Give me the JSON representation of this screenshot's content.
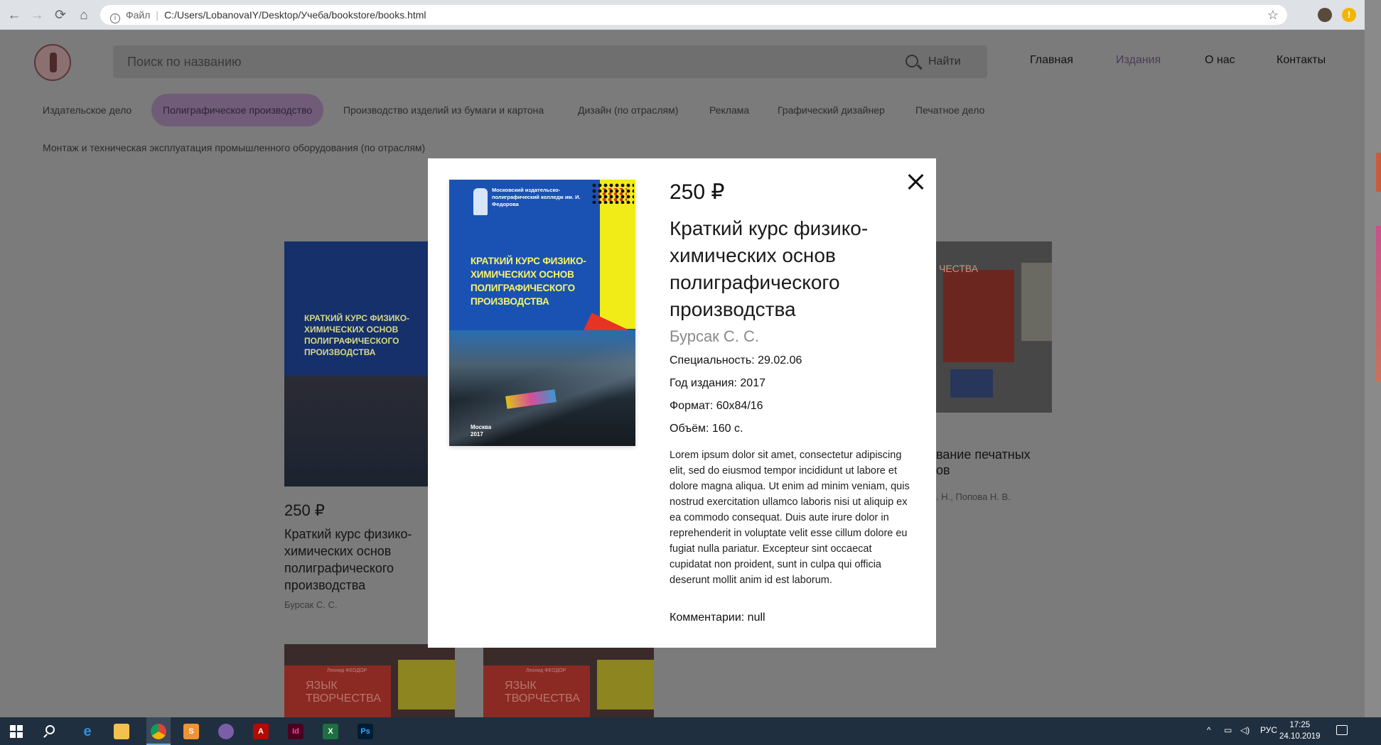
{
  "browser": {
    "scheme_label": "Файл",
    "url": "C:/Users/LobanovaIY/Desktop/Учеба/bookstore/books.html"
  },
  "header": {
    "search_placeholder": "Поиск по названию",
    "search_button": "Найти",
    "nav": [
      "Главная",
      "Издания",
      "О нас",
      "Контакты"
    ],
    "active_nav": "Издания"
  },
  "categories": [
    "Издательское дело",
    "Полиграфическое производство",
    "Производство изделий из бумаги и картона",
    "Дизайн (по отраслям)",
    "Реклама",
    "Графический дизайнер",
    "Печатное дело",
    "Монтаж и техническая эксплуатация промышленного оборудования (по отраслям)"
  ],
  "active_category": "Полиграфическое производство",
  "background_cards": {
    "card1": {
      "price": "250 ₽",
      "title": "Краткий курс физико-химических основ полиграфического производства",
      "author": "Бурсак С. С."
    },
    "card3_partial": {
      "title_line1": "вание печатных",
      "title_line2": "ов",
      "author": ". Н., Попова Н. В."
    }
  },
  "modal": {
    "price": "250 ₽",
    "title": "Краткий курс физико-химических основ полиграфического производства",
    "author": "Бурсак С. С.",
    "specialty": "Специальность: 29.02.06",
    "year": "Год издания: 2017",
    "format": "Формат: 60x84/16",
    "volume": "Объём: 160 с.",
    "description": "Lorem ipsum dolor sit amet, consectetur adipiscing elit, sed do eiusmod tempor incididunt ut labore et dolore magna aliqua. Ut enim ad minim veniam, quis nostrud exercitation ullamco laboris nisi ut aliquip ex ea commodo consequat. Duis aute irure dolor in reprehenderit in voluptate velit esse cillum dolore eu fugiat nulla pariatur. Excepteur sint occaecat cupidatat non proident, sunt in culpa qui officia deserunt mollit anim id est laborum.",
    "comments": "Комментарии: null",
    "cover": {
      "publisher": "Московский издательско-полиграфический колледж им. И. Федорова",
      "title": "КРАТКИЙ КУРС ФИЗИКО-ХИМИЧЕСКИХ ОСНОВ ПОЛИГРАФИЧЕСКОГО ПРОИЗВОДСТВА",
      "city": "Москва",
      "year": "2017"
    }
  },
  "red_covers": {
    "author_label": "Леонид ФЕОДОР",
    "title": "ЯЗЫК ТВОРЧЕСТВА"
  },
  "partial_cover_title": "ЧЕСТВА",
  "taskbar": {
    "language": "РУС",
    "time": "17:25",
    "date": "24.10.2019"
  },
  "colors": {
    "overlay": "#7b7b7b",
    "modal_bg": "#ffffff",
    "active_nav": "#4d3a5c",
    "active_category_bg": "#705c78",
    "taskbar": "#1f2f40"
  }
}
